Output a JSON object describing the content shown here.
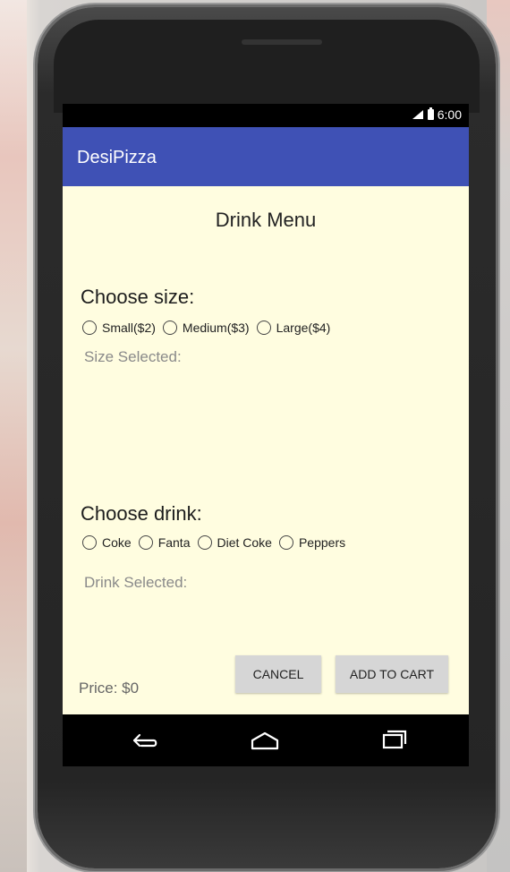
{
  "status": {
    "time": "6:00"
  },
  "app": {
    "title": "DesiPizza"
  },
  "menu": {
    "title": "Drink Menu"
  },
  "size": {
    "title": "Choose size:",
    "options": [
      "Small($2)",
      "Medium($3)",
      "Large($4)"
    ],
    "selected_label": "Size Selected:"
  },
  "drink": {
    "title": "Choose drink:",
    "options": [
      "Coke",
      "Fanta",
      "Diet Coke",
      "Peppers"
    ],
    "selected_label": "Drink Selected:"
  },
  "footer": {
    "price": "Price: $0",
    "cancel": "CANCEL",
    "add": "ADD TO CART"
  }
}
